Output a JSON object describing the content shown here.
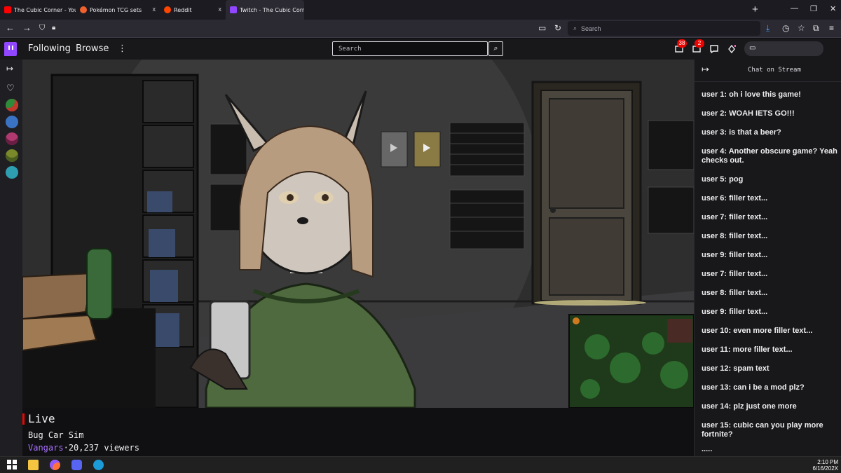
{
  "browser": {
    "tabs": [
      {
        "label": "The Cubic Corner - YouTube",
        "favicon_color": "#ff0000",
        "active": false
      },
      {
        "label": "Pokémon TCG sets",
        "favicon_color": "#f0612e",
        "active": false
      },
      {
        "label": "Reddit",
        "favicon_color": "#ff4500",
        "active": false
      },
      {
        "label": "Twitch - The Cubic Corner",
        "favicon_color": "#9146ff",
        "active": true
      }
    ],
    "close_glyph": "x",
    "new_tab_glyph": "+",
    "url_placeholder": "Search"
  },
  "twitch": {
    "nav": {
      "following": "Following",
      "browse": "Browse",
      "more": "⋮"
    },
    "search_placeholder": "Search",
    "notifications": {
      "inbox_count": "38",
      "whispers_count": "2"
    },
    "accent": "#9146ff",
    "badge_color": "#eb0400"
  },
  "sidebar": {
    "expand_glyph": "↦",
    "followed_channels": [
      {
        "icon": "heart-outline-icon",
        "color": "#efeff1"
      },
      {
        "icon": "avatar",
        "color": "#2e8b3a"
      },
      {
        "icon": "avatar",
        "color": "#3b73c4"
      },
      {
        "icon": "avatar",
        "color": "#b03a6f"
      },
      {
        "icon": "avatar",
        "color": "#7a8a2a"
      },
      {
        "icon": "avatar",
        "color": "#2e9fb0"
      }
    ]
  },
  "stream": {
    "live_label": "Live",
    "game": "Bug Car Sim",
    "streamer": "Vangars",
    "viewers_text": "20,237 viewers"
  },
  "chat": {
    "title": "Chat on Stream",
    "collapse_glyph": "↦",
    "messages": [
      "user 1: oh i love this game!",
      "user 2: WOAH IETS GO!!!",
      "user 3: is that a beer?",
      "user 4: Another obscure game? Yeah checks out.",
      "user 5: pog",
      "user 6: filler text...",
      "user 7: filler text...",
      "user 8: filler text...",
      "user 9: filler text...",
      "user 7: filler text...",
      "user 8: filler text...",
      "user 9: filler text...",
      "user 10: even more filler text...",
      "user 11: more filler text...",
      "user 12: spam text",
      "user 13: can i be a mod plz?",
      "user 14: plz just one more",
      "user 15: cubic can you play more fortnite?"
    ],
    "ellipsis": "....."
  },
  "taskbar": {
    "time": "2:10 PM",
    "date": "6/16/202X",
    "apps": [
      {
        "icon": "windows-start-icon",
        "color": "#ffffff"
      },
      {
        "icon": "file-explorer-icon",
        "color": "#f5c542"
      },
      {
        "icon": "firefox-icon",
        "color": "#ff7139"
      },
      {
        "icon": "discord-icon",
        "color": "#5865f2"
      },
      {
        "icon": "steam-icon",
        "color": "#1b9cd8"
      }
    ]
  }
}
